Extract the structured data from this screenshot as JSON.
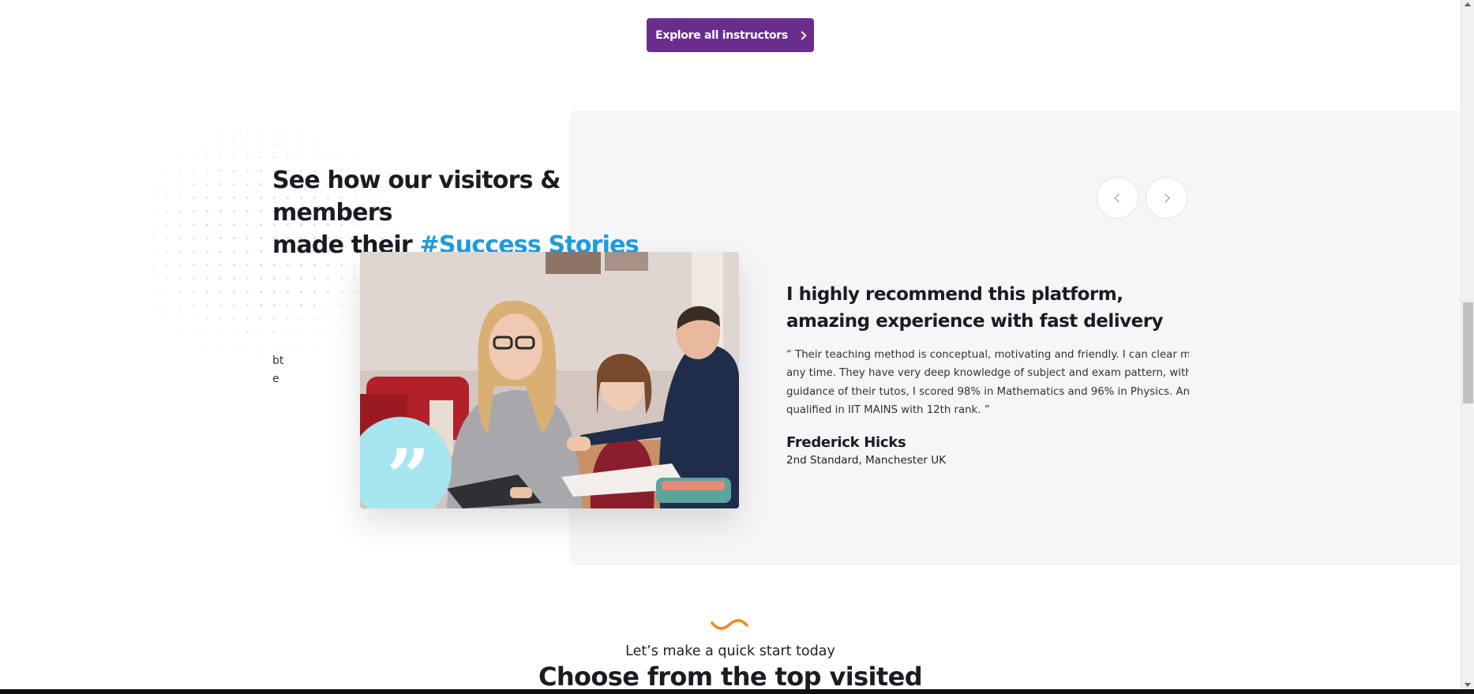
{
  "top_cta": {
    "label": "Explore all instructors",
    "icon": "chevron-right-icon"
  },
  "success_section": {
    "heading_line1": "See how our visitors & members",
    "heading_line2_prefix": "made their ",
    "heading_accent": "#Success Stories",
    "accent_color": "#1f9ce0",
    "stray_line1": "bt",
    "stray_line2": "e",
    "prev_icon": "chevron-left-icon",
    "next_icon": "chevron-right-icon",
    "photo_alt": "woman, girl and man studying at a table",
    "quote_icon": "quote-mark-icon",
    "badge_color": "#a6e6ef"
  },
  "testimonial": {
    "title": "I highly recommend this platform, amazing experience with fast delivery",
    "quote_lines": [
      "“ Their teaching method is conceptual, motivating and friendly. I can clear my doubts",
      "any time. They have very deep knowledge of subject and exam pattern, with the",
      "guidance of their tutos, I scored 98% in Mathematics and 96% in Physics. And",
      "qualified in IIT MAINS with 12th rank. ”"
    ],
    "author_name": "Frederick Hicks",
    "author_role": "2nd Standard, Manchester UK"
  },
  "next_section": {
    "eyebrow": "Let’s make a quick start today",
    "heading": "Choose from the top visited"
  },
  "colors": {
    "primary_button": "#6a2d8c",
    "squiggle": "#f08a24",
    "panel_bg": "#f6f6f9"
  }
}
